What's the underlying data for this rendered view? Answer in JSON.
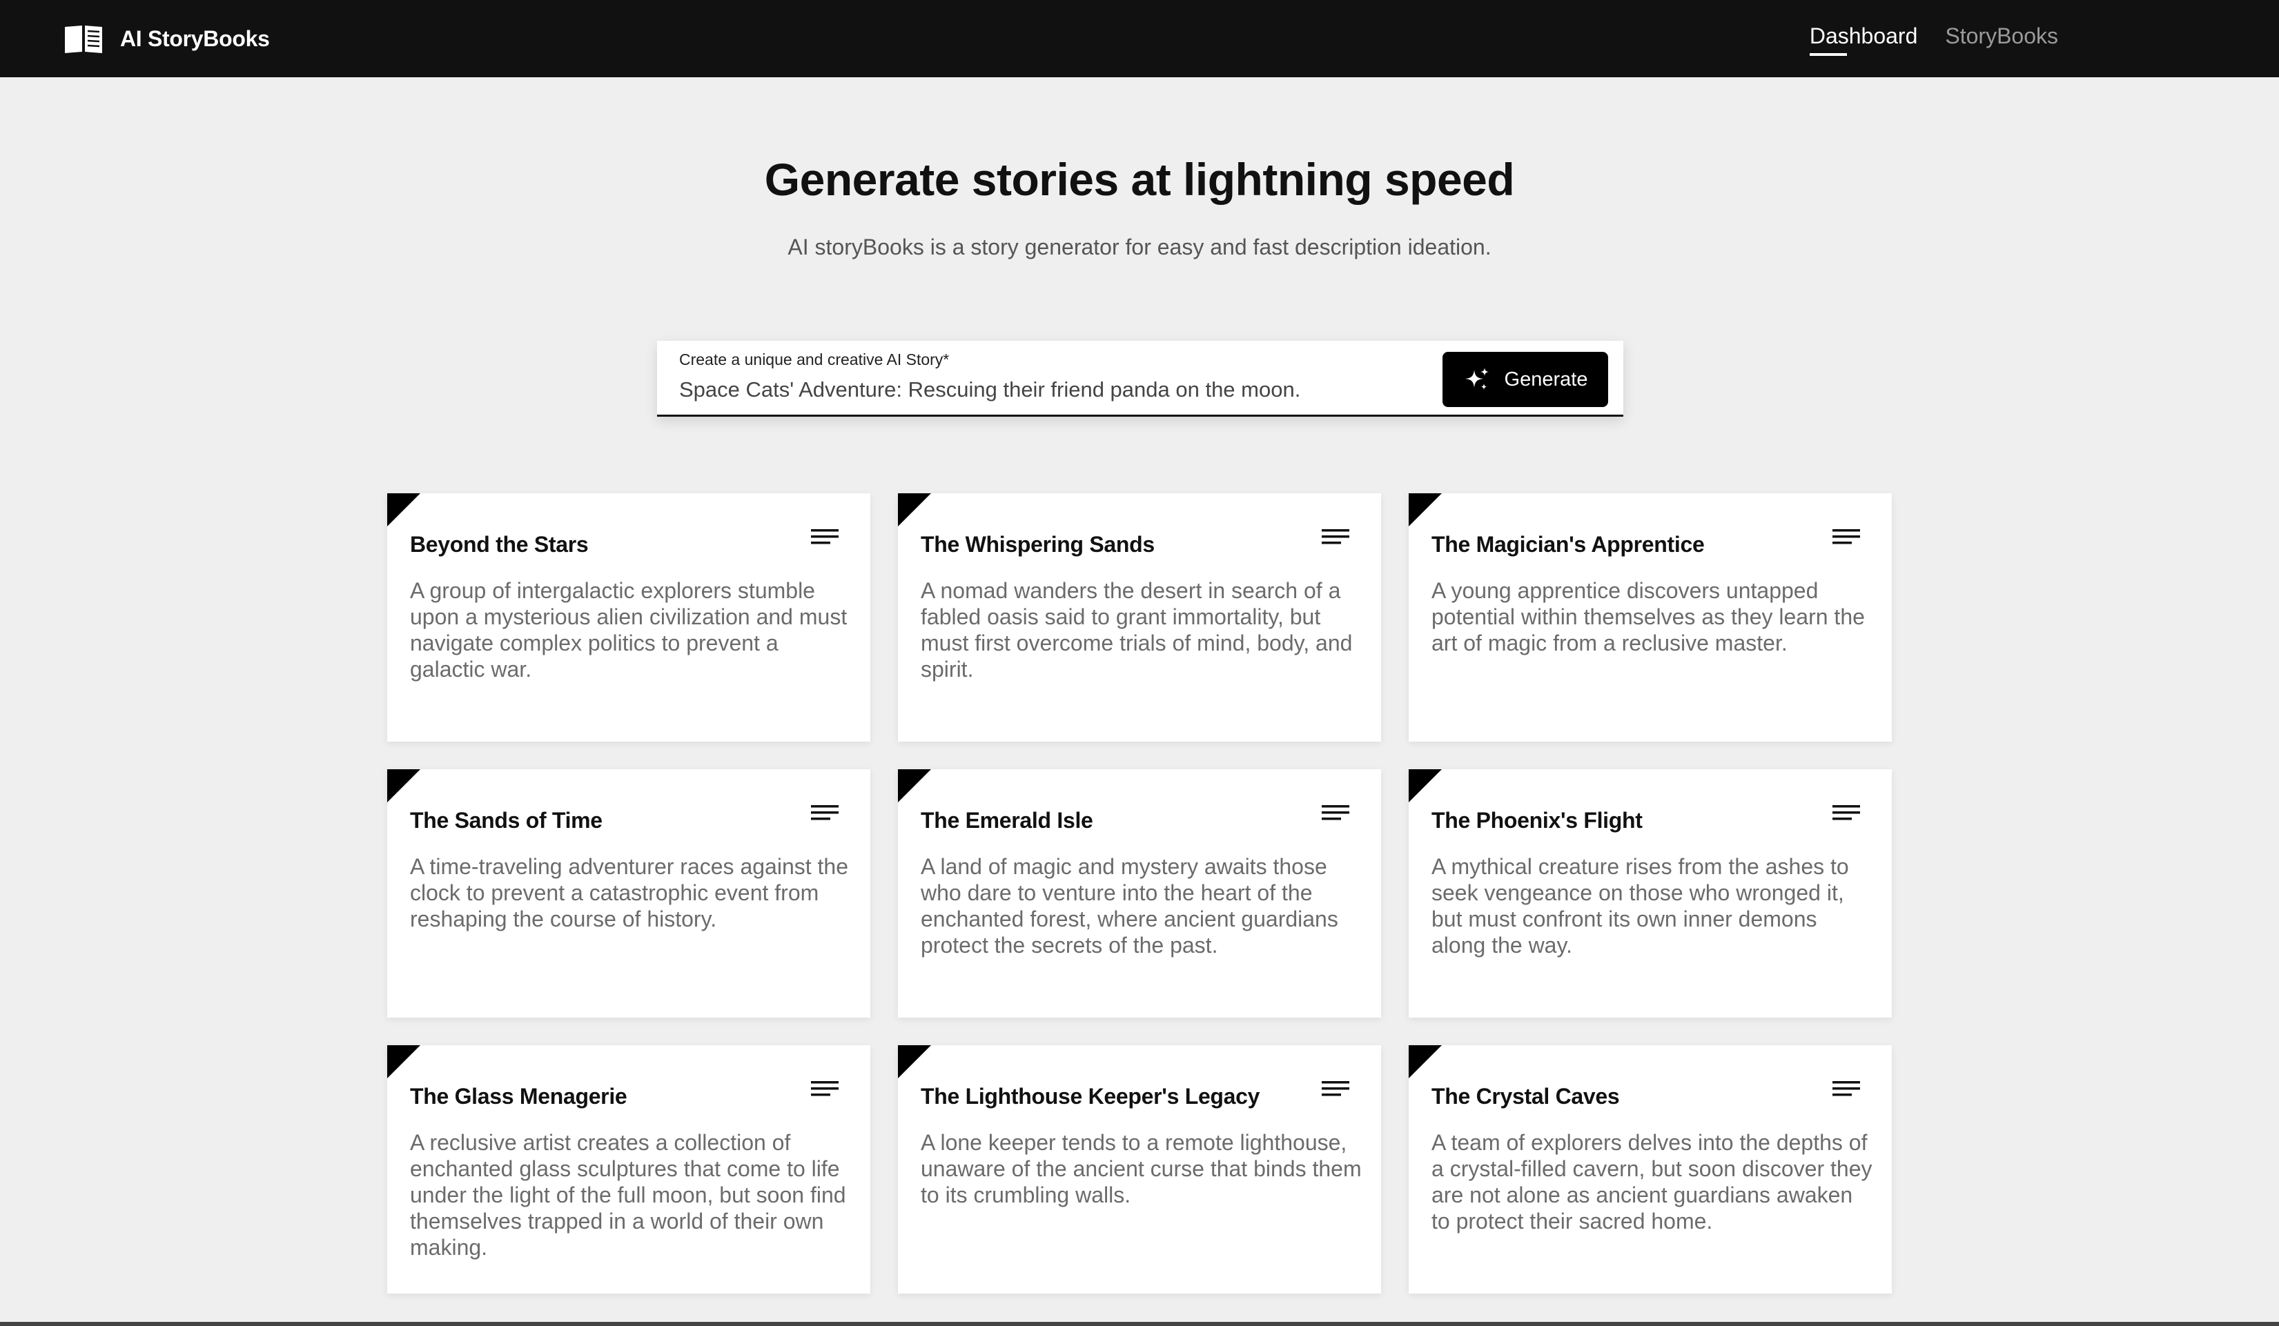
{
  "nav": {
    "brand_name": "AI StoryBooks",
    "brand_icon": "book-open-icon",
    "links": [
      {
        "label": "Dashboard",
        "active": true
      },
      {
        "label": "StoryBooks",
        "active": false
      }
    ]
  },
  "hero": {
    "title": "Generate stories at lightning speed",
    "subtitle": "AI storyBooks is a story generator for easy and fast description ideation."
  },
  "prompt": {
    "label": "Create a unique and creative AI Story*",
    "value": "Space Cats' Adventure: Rescuing their friend panda on the moon.",
    "button_label": "Generate",
    "button_icon": "sparkles-icon"
  },
  "cards": [
    {
      "title": "Beyond the Stars",
      "description": "A group of intergalactic explorers stumble upon a mysterious alien civilization and must navigate complex politics to prevent a galactic war."
    },
    {
      "title": "The Whispering Sands",
      "description": "A nomad wanders the desert in search of a fabled oasis said to grant immortality, but must first overcome trials of mind, body, and spirit."
    },
    {
      "title": "The Magician's Apprentice",
      "description": "A young apprentice discovers untapped potential within themselves as they learn the art of magic from a reclusive master."
    },
    {
      "title": "The Sands of Time",
      "description": "A time-traveling adventurer races against the clock to prevent a catastrophic event from reshaping the course of history."
    },
    {
      "title": "The Emerald Isle",
      "description": "A land of magic and mystery awaits those who dare to venture into the heart of the enchanted forest, where ancient guardians protect the secrets of the past."
    },
    {
      "title": "The Phoenix's Flight",
      "description": "A mythical creature rises from the ashes to seek vengeance on those who wronged it, but must confront its own inner demons along the way."
    },
    {
      "title": "The Glass Menagerie",
      "description": "A reclusive artist creates a collection of enchanted glass sculptures that come to life under the light of the full moon, but soon find themselves trapped in a world of their own making."
    },
    {
      "title": "The Lighthouse Keeper's Legacy",
      "description": "A lone keeper tends to a remote lighthouse, unaware of the ancient curse that binds them to its crumbling walls."
    },
    {
      "title": "The Crystal Caves",
      "description": "A team of explorers delves into the depths of a crystal-filled cavern, but soon discover they are not alone as ancient guardians awaken to protect their sacred home."
    }
  ],
  "colors": {
    "nav_bg": "#111111",
    "page_bg": "#efefef",
    "accent": "#000000",
    "card_bg": "#ffffff",
    "muted_text": "#6b6b6b"
  }
}
